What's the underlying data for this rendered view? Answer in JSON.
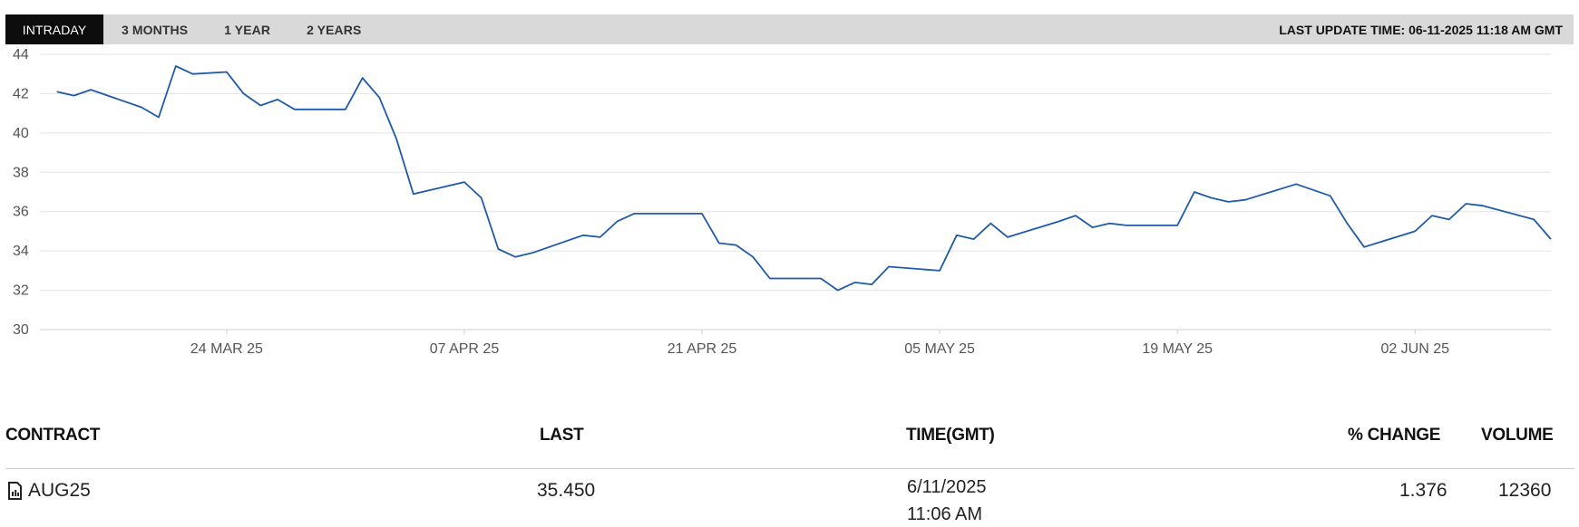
{
  "tabs": [
    {
      "label": "INTRADAY",
      "active": true
    },
    {
      "label": "3 MONTHS",
      "active": false
    },
    {
      "label": "1 YEAR",
      "active": false
    },
    {
      "label": "2 YEARS",
      "active": false
    }
  ],
  "last_update": "LAST UPDATE TIME: 06-11-2025 11:18 AM GMT",
  "colors": {
    "line": "#1f5ba8",
    "grid": "#e3e3e3",
    "active_tab": "#0d0d0d",
    "tabbar": "#d9d9d9"
  },
  "chart_data": {
    "type": "line",
    "title": "",
    "xlabel": "",
    "ylabel": "",
    "ylim": [
      30,
      44
    ],
    "yticks": [
      30,
      32,
      34,
      36,
      38,
      40,
      42,
      44
    ],
    "xlim": [
      "2025-03-13",
      "2025-06-10"
    ],
    "xticks": [
      {
        "date": "2025-03-24",
        "label": "24 MAR 25"
      },
      {
        "date": "2025-04-07",
        "label": "07 APR 25"
      },
      {
        "date": "2025-04-21",
        "label": "21 APR 25"
      },
      {
        "date": "2025-05-05",
        "label": "05 MAY 25"
      },
      {
        "date": "2025-05-19",
        "label": "19 MAY 25"
      },
      {
        "date": "2025-06-02",
        "label": "02 JUN 25"
      }
    ],
    "grid": true,
    "series": [
      {
        "x": [
          "2025-03-14",
          "2025-03-15",
          "2025-03-16",
          "2025-03-19",
          "2025-03-20",
          "2025-03-21",
          "2025-03-22",
          "2025-03-24",
          "2025-03-25",
          "2025-03-26",
          "2025-03-27",
          "2025-03-28",
          "2025-03-31",
          "2025-04-01",
          "2025-04-02",
          "2025-04-03",
          "2025-04-04",
          "2025-04-07",
          "2025-04-08",
          "2025-04-09",
          "2025-04-10",
          "2025-04-11",
          "2025-04-14",
          "2025-04-15",
          "2025-04-16",
          "2025-04-17",
          "2025-04-21",
          "2025-04-22",
          "2025-04-23",
          "2025-04-24",
          "2025-04-25",
          "2025-04-28",
          "2025-04-29",
          "2025-04-30",
          "2025-05-01",
          "2025-05-02",
          "2025-05-05",
          "2025-05-06",
          "2025-05-07",
          "2025-05-08",
          "2025-05-09",
          "2025-05-12",
          "2025-05-13",
          "2025-05-14",
          "2025-05-15",
          "2025-05-16",
          "2025-05-19",
          "2025-05-20",
          "2025-05-21",
          "2025-05-22",
          "2025-05-23",
          "2025-05-26",
          "2025-05-28",
          "2025-05-29",
          "2025-05-30",
          "2025-06-02",
          "2025-06-03",
          "2025-06-04",
          "2025-06-05",
          "2025-06-06",
          "2025-06-09",
          "2025-06-10"
        ],
        "y": [
          42.1,
          41.9,
          42.2,
          41.3,
          40.8,
          43.4,
          43.0,
          43.1,
          42.0,
          41.4,
          41.7,
          41.2,
          41.2,
          42.8,
          41.8,
          39.7,
          36.9,
          37.5,
          36.7,
          34.1,
          33.7,
          33.9,
          34.8,
          34.7,
          35.5,
          35.9,
          35.9,
          34.4,
          34.3,
          33.7,
          32.6,
          32.6,
          32.0,
          32.4,
          32.3,
          33.2,
          33.0,
          34.8,
          34.6,
          35.4,
          34.7,
          35.5,
          35.8,
          35.2,
          35.4,
          35.3,
          35.3,
          37.0,
          36.7,
          36.5,
          36.6,
          37.4,
          36.8,
          35.4,
          34.2,
          35.0,
          35.8,
          35.6,
          36.4,
          36.3,
          35.6,
          34.6
        ]
      }
    ]
  },
  "table": {
    "headers": {
      "contract": "CONTRACT",
      "last": "LAST",
      "time": "TIME(GMT)",
      "change": "% CHANGE",
      "volume": "VOLUME"
    },
    "rows": [
      {
        "contract": "AUG25",
        "last": "35.450",
        "date": "6/11/2025",
        "time": "11:06 AM",
        "change": "1.376",
        "volume": "12360",
        "icon": "document-chart-icon"
      }
    ]
  }
}
